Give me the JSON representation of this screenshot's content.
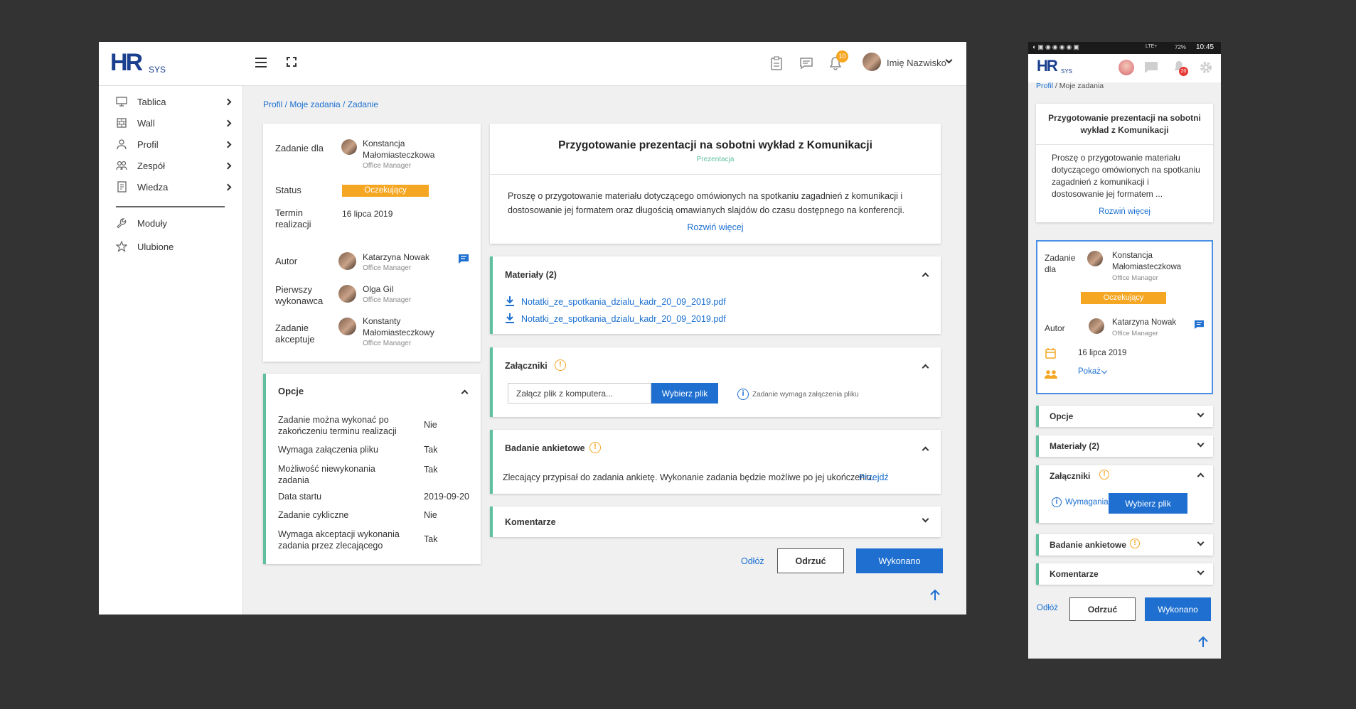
{
  "desktop": {
    "logo": {
      "hr": "HR",
      "sys": "SYS"
    },
    "header": {
      "notif_count": "10",
      "user_name": "Imię Nazwisko"
    },
    "sidebar": {
      "items": [
        {
          "label": "Tablica",
          "icon": "monitor-icon"
        },
        {
          "label": "Wall",
          "icon": "wall-icon"
        },
        {
          "label": "Profil",
          "icon": "user-icon"
        },
        {
          "label": "Zespół",
          "icon": "team-icon"
        },
        {
          "label": "Wiedza",
          "icon": "book-icon"
        }
      ],
      "extra": [
        {
          "label": "Moduły",
          "icon": "wrench-icon"
        },
        {
          "label": "Ulubione",
          "icon": "star-icon"
        }
      ]
    },
    "breadcrumb": "Profil / Moje zadania / Zadanie",
    "details": {
      "assigned_label": "Zadanie dla",
      "assigned_name": "Konstancja Małomiasteczkowa",
      "assigned_role": "Office Manager",
      "status_label": "Status",
      "status_value": "Oczekujący",
      "deadline_label": "Termin realizacji",
      "deadline_value": "16 lipca 2019",
      "author_label": "Autor",
      "author_name": "Katarzyna Nowak",
      "author_role": "Office Manager",
      "first_label": "Pierwszy wykonawca",
      "first_name": "Olga Gil",
      "first_role": "Office Manager",
      "accept_label": "Zadanie akceptuje",
      "accept_name": "Konstanty Małomiasteczkowy",
      "accept_role": "Office Manager"
    },
    "options": {
      "title": "Opcje",
      "rows": [
        {
          "label": "Zadanie można wykonać po zakończeniu terminu realizacji",
          "value": "Nie"
        },
        {
          "label": "Wymaga załączenia pliku",
          "value": "Tak"
        },
        {
          "label": "Możliwość niewykonania zadania",
          "value": "Tak"
        },
        {
          "label": "Data startu",
          "value": "2019-09-20"
        },
        {
          "label": "Zadanie cykliczne",
          "value": "Nie"
        },
        {
          "label": "Wymaga akceptacji wykonania zadania przez zlecającego",
          "value": "Tak"
        }
      ]
    },
    "task": {
      "title": "Przygotowanie prezentacji na sobotni wykład z Komunikacji",
      "category": "Prezentacja",
      "description": "Proszę o przygotowanie materiału dotyczącego omówionych na spotkaniu zagadnień z komunikacji i dostosowanie jej formatem oraz długością omawianych slajdów do czasu dostępnego na konferencji.",
      "expand": "Rozwiń więcej"
    },
    "materials": {
      "title": "Materiały (2)",
      "files": [
        "Notatki_ze_spotkania_dzialu_kadr_20_09_2019.pdf",
        "Notatki_ze_spotkania_dzialu_kadr_20_09_2019.pdf"
      ]
    },
    "attachments": {
      "title": "Załączniki",
      "input_placeholder": "Załącz plik z komputera...",
      "choose": "Wybierz plik",
      "note": "Zadanie wymaga załączenia pliku"
    },
    "survey": {
      "title": "Badanie ankietowe",
      "text": "Zlecający przypisał do zadania ankietę. Wykonanie zadania będzie możliwe po jej ukończeniu.",
      "link": "Przejdź"
    },
    "comments": {
      "title": "Komentarze"
    },
    "actions": {
      "postpone": "Odłóż",
      "reject": "Odrzuć",
      "done": "Wykonano"
    }
  },
  "mobile": {
    "statusbar": {
      "battery": "72%",
      "time": "10:45",
      "signal": "LTE+"
    },
    "notif_count": "20",
    "breadcrumb_link": "Profil",
    "breadcrumb_rest": " / Moje zadania",
    "task_title": "Przygotowanie prezentacji na sobotni wykład z Komunikacji",
    "task_desc": "Proszę o przygotowanie materiału dotyczącego omówionych na spotkaniu zagadnień z komunikacji i dostosowanie jej formatem ...",
    "expand": "Rozwiń więcej",
    "assigned_label": "Zadanie dla",
    "assigned_name": "Konstancja Małomiasteczkowa",
    "assigned_role": "Office Manager",
    "status": "Oczekujący",
    "author_label": "Autor",
    "author_name": "Katarzyna Nowak",
    "author_role": "Office Manager",
    "date": "16 lipca 2019",
    "show": "Pokaż",
    "sections": {
      "options": "Opcje",
      "materials": "Materiały (2)",
      "attachments": "Załączniki",
      "survey": "Badanie ankietowe",
      "comments": "Komentarze"
    },
    "requirements": "Wymagania",
    "choose": "Wybierz plik",
    "actions": {
      "postpone": "Odłóż",
      "reject": "Odrzuć",
      "done": "Wykonano"
    }
  },
  "colors": {
    "accent": "#1e6fd0",
    "status": "#f5a623",
    "section_border": "#5fbf9f",
    "background": "#333333"
  }
}
